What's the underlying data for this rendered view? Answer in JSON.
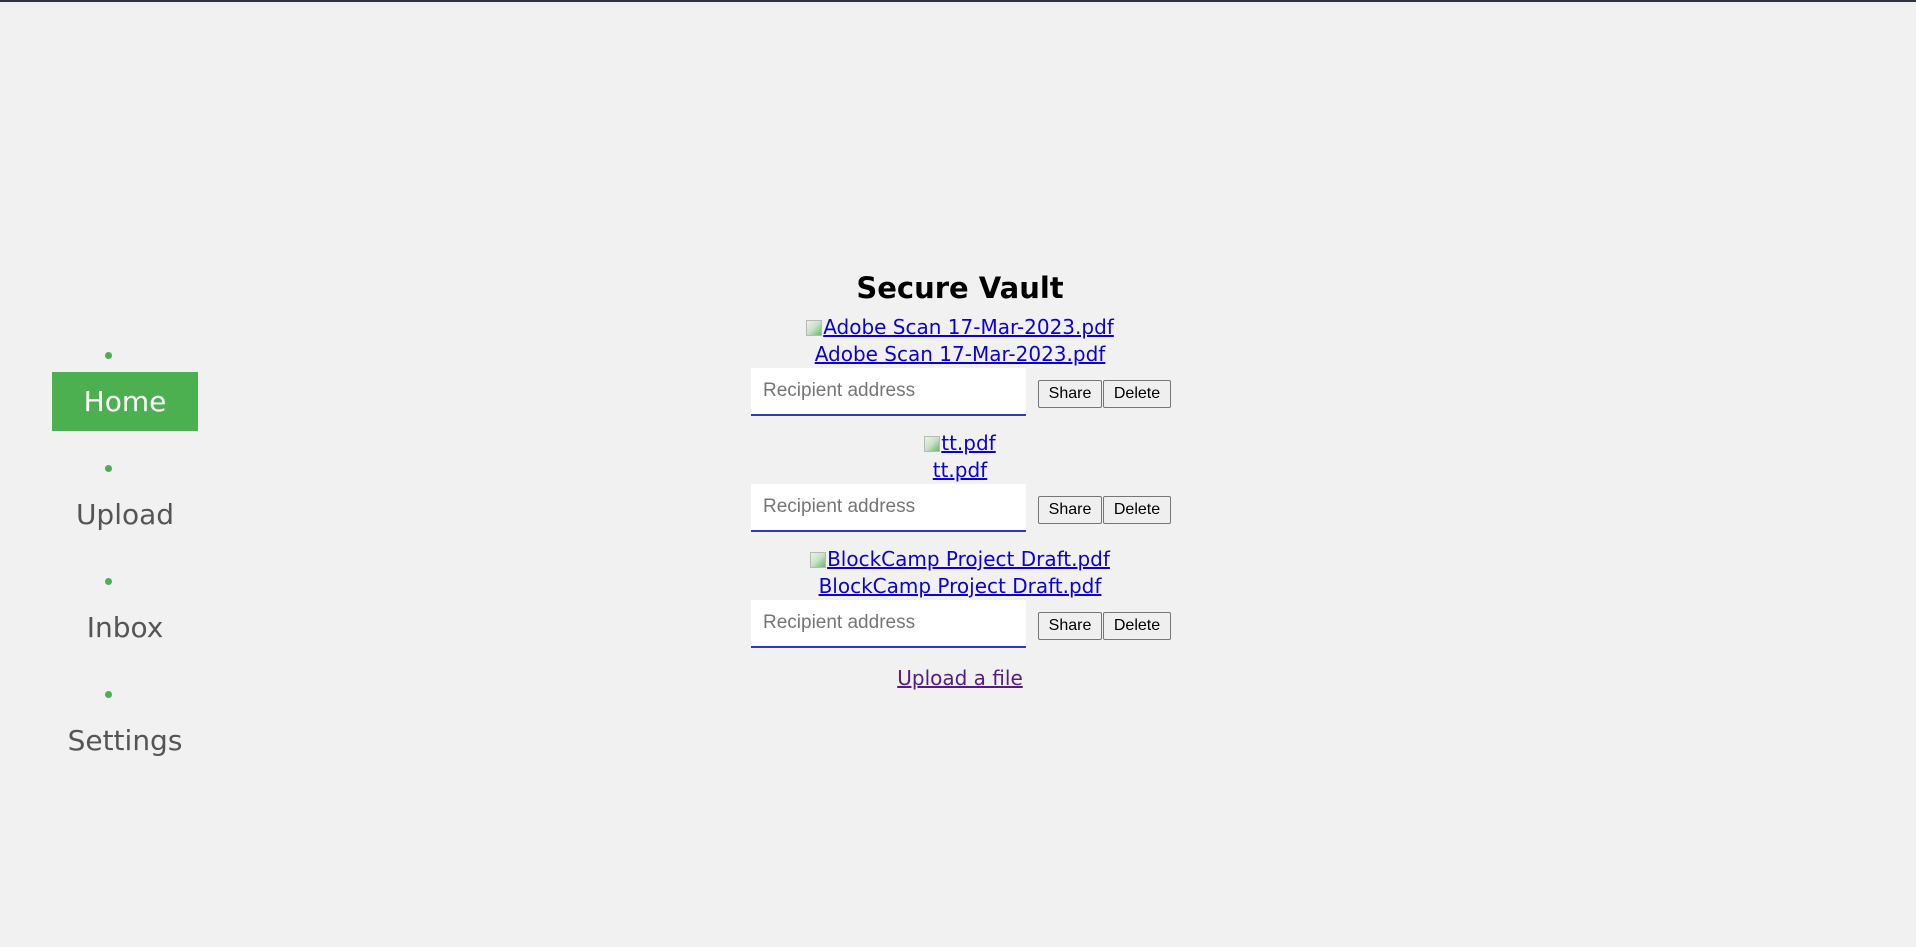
{
  "nav": {
    "items": [
      {
        "label": "Home",
        "active": true
      },
      {
        "label": "Upload",
        "active": false
      },
      {
        "label": "Inbox",
        "active": false
      },
      {
        "label": "Settings",
        "active": false
      }
    ],
    "accent_color": "#4caf50"
  },
  "vault": {
    "title": "Secure Vault",
    "files": [
      {
        "name": "Adobe Scan 17-Mar-2023.pdf",
        "image_alt": "Adobe Scan 17-Mar-2023.pdf",
        "recipient_placeholder": "Recipient address",
        "recipient_value": "",
        "share_label": "Share",
        "delete_label": "Delete"
      },
      {
        "name": "tt.pdf",
        "image_alt": "tt.pdf",
        "recipient_placeholder": "Recipient address",
        "recipient_value": "",
        "share_label": "Share",
        "delete_label": "Delete"
      },
      {
        "name": "BlockCamp Project Draft.pdf",
        "image_alt": "BlockCamp Project Draft.pdf",
        "recipient_placeholder": "Recipient address",
        "recipient_value": "",
        "share_label": "Share",
        "delete_label": "Delete"
      }
    ],
    "upload_link": "Upload a file"
  },
  "icons": {
    "broken_image": "broken-image-icon",
    "nav_bullet": "bullet-icon"
  }
}
